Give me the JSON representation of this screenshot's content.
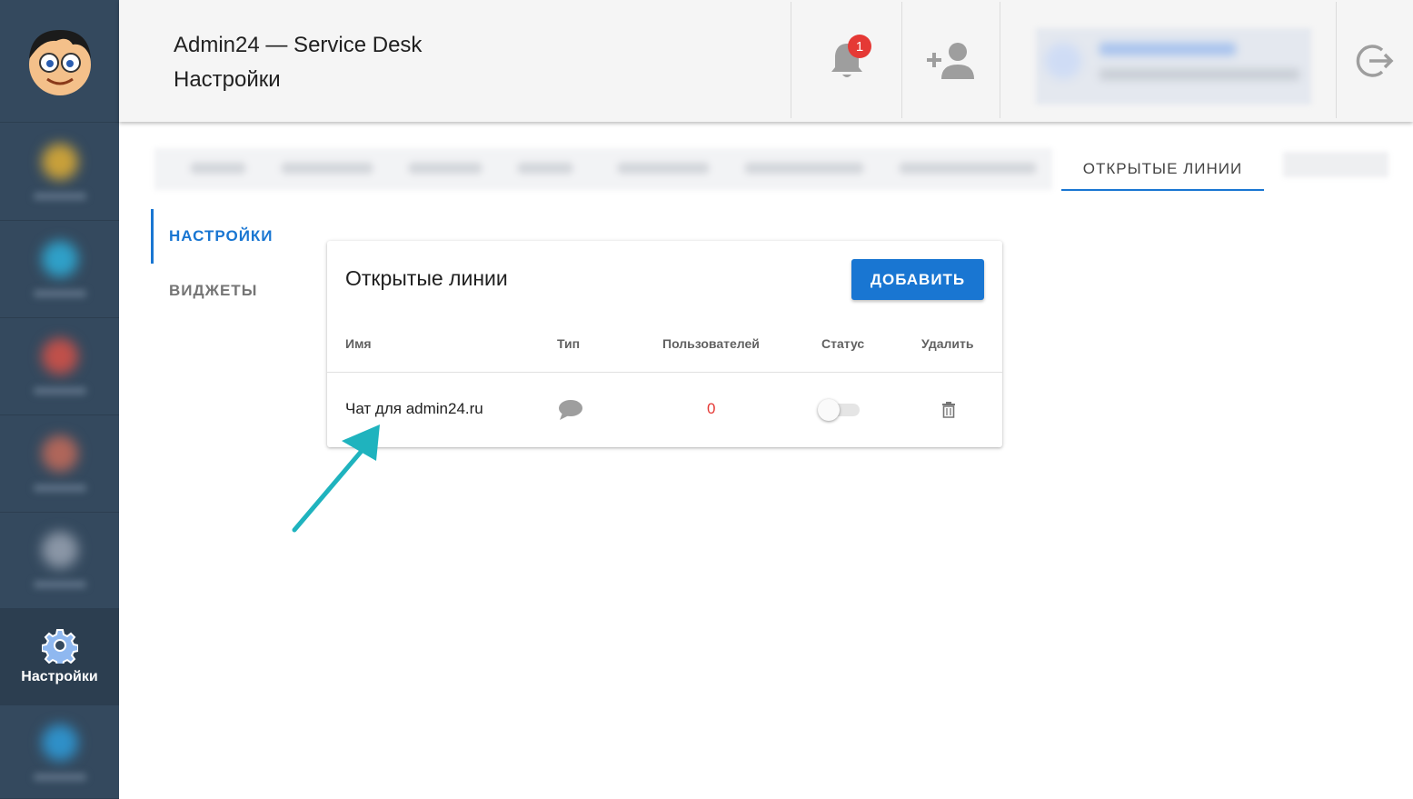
{
  "app": {
    "title": "Admin24 — Service Desk",
    "subtitle": "Настройки"
  },
  "header": {
    "notifications_count": "1"
  },
  "sidebar": {
    "active_label": "Настройки"
  },
  "tabs": {
    "active_label": "ОТКРЫТЫЕ ЛИНИИ"
  },
  "submenu": {
    "items": [
      {
        "label": "НАСТРОЙКИ",
        "active": true
      },
      {
        "label": "ВИДЖЕТЫ",
        "active": false
      }
    ]
  },
  "card": {
    "title": "Открытые линии",
    "add_button": "ДОБАВИТЬ",
    "columns": [
      "Имя",
      "Тип",
      "Пользователей",
      "Статус",
      "Удалить"
    ],
    "rows": [
      {
        "name": "Чат для admin24.ru",
        "type_icon": "chat-bubble-icon",
        "users": "0",
        "status": false,
        "delete_icon": "trash-icon"
      }
    ]
  },
  "colors": {
    "accent": "#1976d2",
    "sidebar": "#34495e",
    "badge": "#e53935",
    "arrow": "#1fb3be"
  }
}
